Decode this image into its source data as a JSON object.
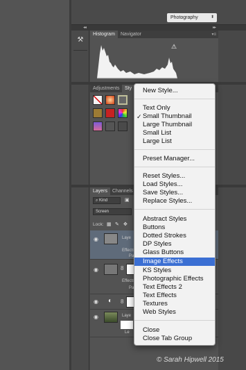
{
  "workspace": {
    "selected": "Photography"
  },
  "panels": {
    "histogram": {
      "tabs": [
        "Histogram",
        "Navigator"
      ],
      "warning_icon": "warning-triangle-icon"
    },
    "adjustments": {
      "tabs": [
        "Adjustments",
        "Sty"
      ]
    },
    "layers": {
      "tabs": [
        "Layers",
        "Channels"
      ],
      "filter_label": "Kind",
      "blend_mode": "Screen",
      "lock_label": "Lock:",
      "rows": [
        {
          "name": "Laye",
          "sub": [
            "Effects",
            "Pa"
          ]
        },
        {
          "name": "",
          "sub": [
            "Effects",
            "Pa"
          ]
        },
        {
          "name": ""
        },
        {
          "name": "Laye",
          "sub": [
            "Le"
          ]
        }
      ]
    }
  },
  "menu": {
    "groups": [
      [
        "New Style..."
      ],
      [
        "Text Only",
        "Small Thumbnail",
        "Large Thumbnail",
        "Small List",
        "Large List"
      ],
      [
        "Preset Manager..."
      ],
      [
        "Reset Styles...",
        "Load Styles...",
        "Save Styles...",
        "Replace Styles..."
      ],
      [
        "Abstract Styles",
        "Buttons",
        "Dotted Strokes",
        "DP Styles",
        "Glass Buttons",
        "Image Effects",
        "KS Styles",
        "Photographic Effects",
        "Text Effects 2",
        "Text Effects",
        "Textures",
        "Web Styles"
      ],
      [
        "Close",
        "Close Tab Group"
      ]
    ],
    "checked": "Small Thumbnail",
    "highlighted": "Image Effects"
  },
  "watermark": "© Sarah Hipwell 2015",
  "colors": {
    "menu_highlight": "#3b6fd3",
    "panel_bg": "#535353"
  }
}
